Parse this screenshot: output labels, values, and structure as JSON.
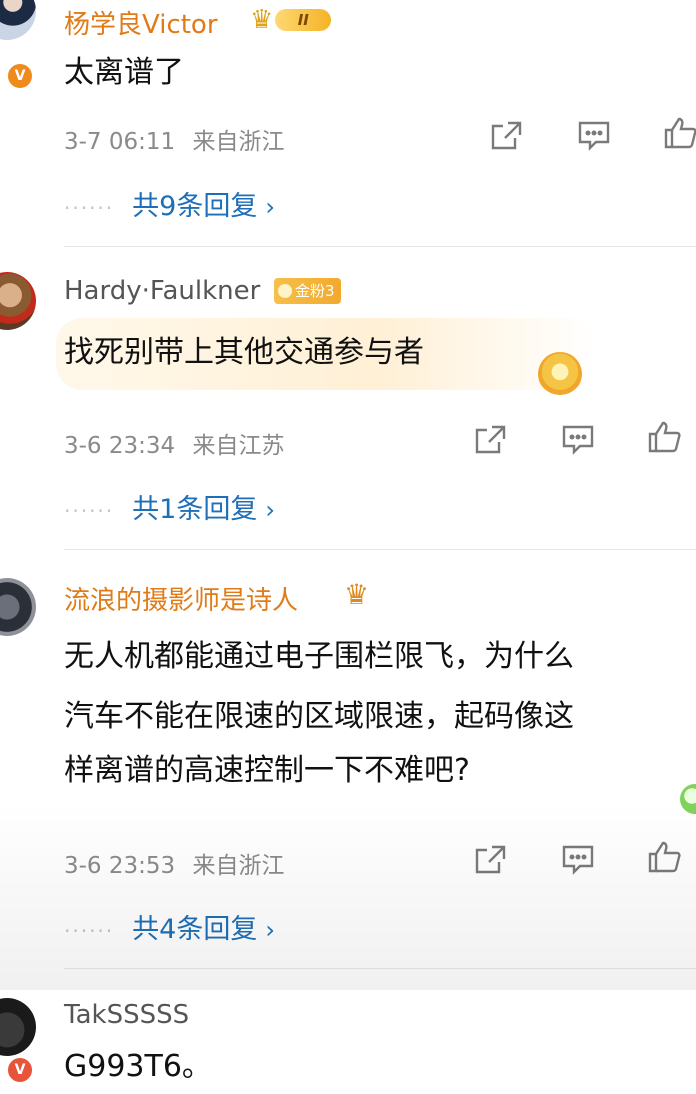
{
  "comments": [
    {
      "username": "杨学良Victor",
      "level_badge": "II",
      "text": "太离谱了",
      "date": "3-7 06:11",
      "location": "来自浙江",
      "replies_label": "共9条回复",
      "verified_badge": "V"
    },
    {
      "username": "Hardy·Faulkner",
      "fan_badge": "金粉3",
      "text": "找死别带上其他交通参与者",
      "date": "3-6 23:34",
      "location": "来自江苏",
      "replies_label": "共1条回复"
    },
    {
      "username": "流浪的摄影师是诗人",
      "text_lines": [
        "无人机都能通过电子围栏限飞，为什么",
        "汽车不能在限速的区域限速，起码像这",
        "样离谱的高速控制一下不难吧?"
      ],
      "date": "3-6 23:53",
      "location": "来自浙江",
      "replies_label": "共4条回复"
    },
    {
      "username": "TakSSSSS",
      "text": "G993T6。",
      "verified_badge": "V"
    }
  ],
  "icons": {
    "share": "share-icon",
    "comment": "comment-icon",
    "like": "like-icon",
    "chevron": "chevron-right-icon"
  },
  "colors": {
    "accent_blue": "#1e6fb8",
    "username_orange": "#e07b17",
    "meta_gray": "#8a8a8a"
  }
}
